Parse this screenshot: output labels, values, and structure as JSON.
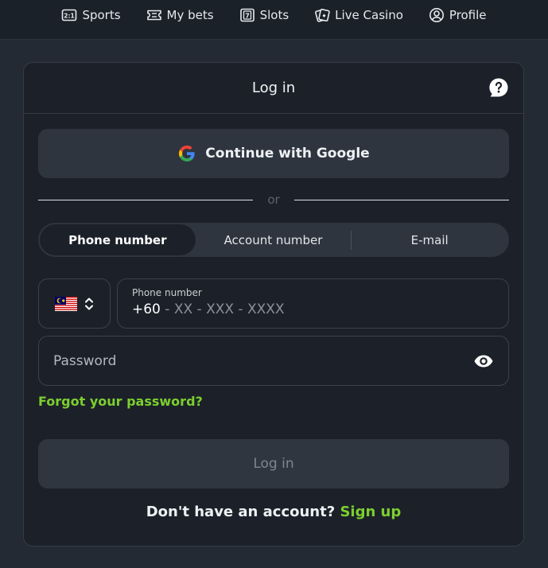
{
  "nav": {
    "items": [
      {
        "label": "Sports",
        "icon": "scoreboard-icon"
      },
      {
        "label": "My bets",
        "icon": "ticket-icon"
      },
      {
        "label": "Slots",
        "icon": "slot-machine-icon"
      },
      {
        "label": "Live Casino",
        "icon": "cards-icon"
      },
      {
        "label": "Profile",
        "icon": "user-circle-icon"
      }
    ]
  },
  "login": {
    "title": "Log in",
    "google_label": "Continue with Google",
    "divider_text": "or",
    "tabs": [
      "Phone number",
      "Account number",
      "E-mail"
    ],
    "active_tab": "Phone number",
    "country": {
      "flag": "malaysia-flag",
      "code": "+60"
    },
    "phone_label": "Phone number",
    "phone_prefix": "+60",
    "phone_mask": " - XX - XXX - XXXX",
    "password_placeholder": "Password",
    "forgot_label": "Forgot your password?",
    "submit_label": "Log in",
    "signup_prompt": "Don't have an account?",
    "signup_link": "Sign up"
  },
  "colors": {
    "accent_green": "#7ccf2f",
    "card_bg": "#1c2129",
    "page_bg": "#232a33",
    "field_bg": "#2e353f"
  }
}
